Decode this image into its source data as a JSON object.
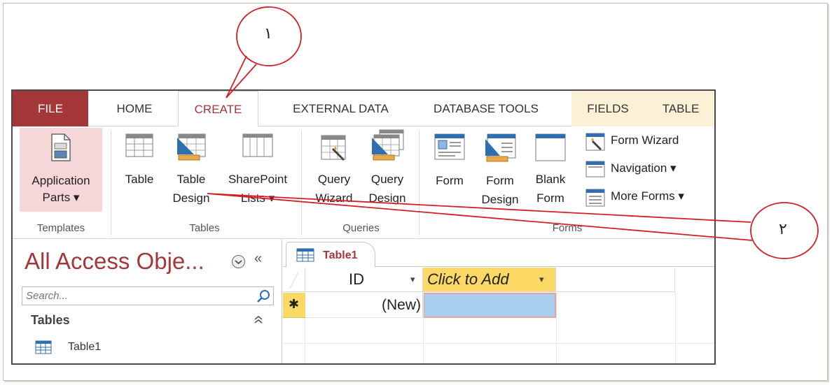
{
  "tabs": {
    "file": "FILE",
    "home": "HOME",
    "create": "CREATE",
    "external_data": "EXTERNAL DATA",
    "database_tools": "DATABASE TOOLS",
    "fields": "FIELDS",
    "table": "TABLE"
  },
  "ribbon": {
    "templates": {
      "application_parts_line1": "Application",
      "application_parts_line2": "Parts ▾",
      "group": "Templates"
    },
    "tables": {
      "table": "Table",
      "table_design_line1": "Table",
      "table_design_line2": "Design",
      "sharepoint_line1": "SharePoint",
      "sharepoint_line2": "Lists ▾",
      "group": "Tables"
    },
    "queries": {
      "query_wizard_line1": "Query",
      "query_wizard_line2": "Wizard",
      "query_design_line1": "Query",
      "query_design_line2": "Design",
      "group": "Queries"
    },
    "forms": {
      "form": "Form",
      "form_design_line1": "Form",
      "form_design_line2": "Design",
      "blank_form_line1": "Blank",
      "blank_form_line2": "Form",
      "form_wizard": "Form Wizard",
      "navigation": "Navigation ▾",
      "more_forms": "More Forms ▾",
      "group": "Forms"
    }
  },
  "nav_pane": {
    "title": "All Access Obje...",
    "collapse": "«",
    "search_placeholder": "Search...",
    "section": "Tables",
    "section_toggle": "≈",
    "items": [
      {
        "label": "Table1"
      }
    ]
  },
  "document": {
    "tab_label": "Table1",
    "columns": [
      {
        "label": "ID",
        "arrow": "▾"
      },
      {
        "label": "Click to Add",
        "arrow": "▾"
      }
    ],
    "new_row_marker": "✱",
    "new_row_id": "(New)"
  },
  "annotations": {
    "callout_1": "١",
    "callout_2": "٢"
  },
  "colors": {
    "accent": "#a4373a",
    "contextual_tab_bg": "#fbf1d6",
    "click_to_add_bg": "#fcd864",
    "selected_cell": "#a9cfee",
    "annotation_red": "#d21f26"
  }
}
